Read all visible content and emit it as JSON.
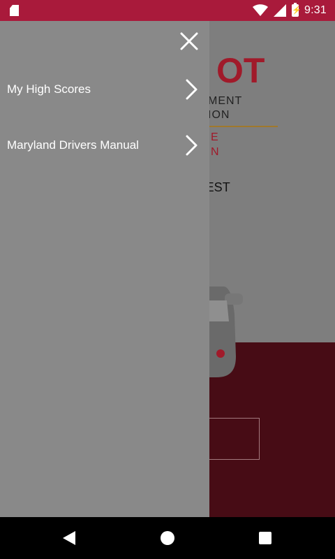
{
  "status_bar": {
    "time": "9:31",
    "icons": [
      "sd-card-icon",
      "wifi-icon",
      "signal-icon",
      "battery-charging-icon"
    ],
    "color": "#a91a3b"
  },
  "background_screen": {
    "logo_mark": "OT",
    "logo_line1": "MENT",
    "logo_line2": "ION",
    "logo_sub1": "E",
    "logo_sub2": "N",
    "title": "RACTICE TEST",
    "accent_color": "#a01a2a",
    "bottom_panel_color": "#470c15"
  },
  "drawer": {
    "close_icon": "close-icon",
    "items": [
      {
        "label": "My High Scores",
        "icon": "chevron-right-icon"
      },
      {
        "label": "Maryland Drivers Manual",
        "icon": "chevron-right-icon"
      }
    ]
  },
  "nav_bar": {
    "buttons": [
      "back-icon",
      "home-icon",
      "recents-icon"
    ]
  }
}
